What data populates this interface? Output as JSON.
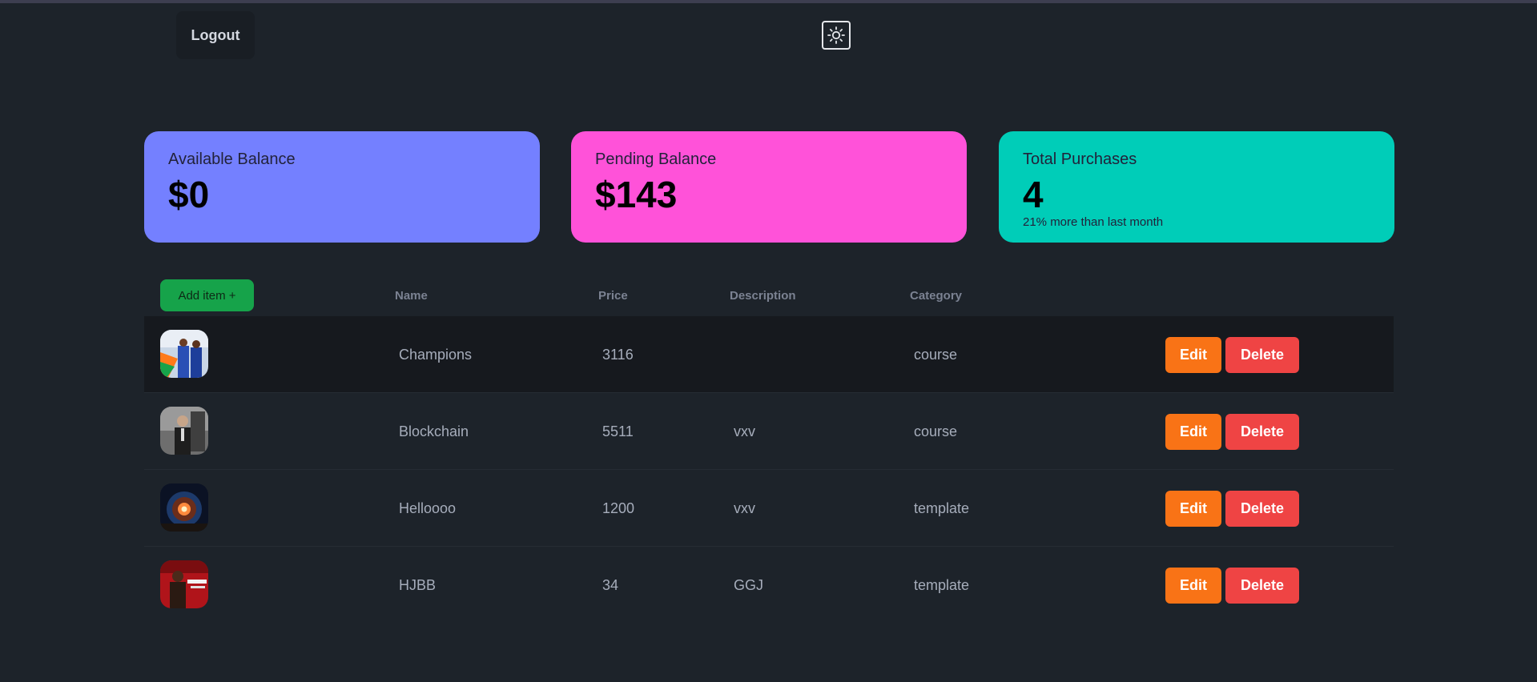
{
  "header": {
    "logout_label": "Logout",
    "theme_icon": "sun-icon"
  },
  "stats": [
    {
      "title": "Available Balance",
      "value": "$0",
      "desc": "",
      "color": "#7480ff"
    },
    {
      "title": "Pending Balance",
      "value": "$143",
      "desc": "",
      "color": "#ff52d9"
    },
    {
      "title": "Total Purchases",
      "value": "4",
      "desc": "21% more than last month",
      "color": "#00cdb8"
    }
  ],
  "table": {
    "add_label": "Add item +",
    "columns": [
      "Name",
      "Price",
      "Description",
      "Category"
    ],
    "rows": [
      {
        "name": "Champions",
        "price": "3116",
        "description": "",
        "category": "course",
        "thumb": "champions-thumbnail"
      },
      {
        "name": "Blockchain",
        "price": "5511",
        "description": "vxv",
        "category": "course",
        "thumb": "blockchain-thumbnail"
      },
      {
        "name": "Helloooo",
        "price": "1200",
        "description": "vxv",
        "category": "template",
        "thumb": "helloooo-thumbnail"
      },
      {
        "name": "HJBB",
        "price": "34",
        "description": "GGJ",
        "category": "template",
        "thumb": "hjbb-thumbnail"
      }
    ],
    "edit_label": "Edit",
    "delete_label": "Delete"
  },
  "colors": {
    "background": "#1d232a",
    "add_button": "#16a34a",
    "edit_button": "#f97316",
    "delete_button": "#ef4444"
  }
}
